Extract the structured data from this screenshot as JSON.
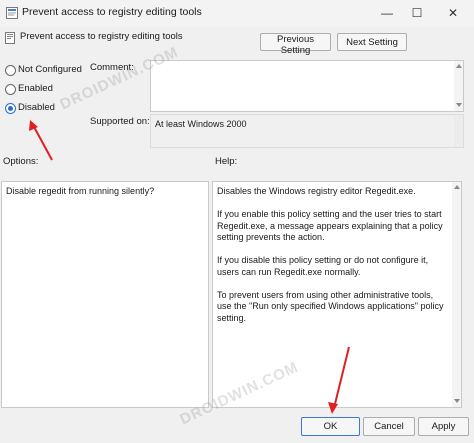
{
  "window": {
    "title": "Prevent access to registry editing tools",
    "minimize_glyph": "—",
    "maximize_glyph": "☐",
    "close_glyph": "✕"
  },
  "header": {
    "policy_title": "Prevent access to registry editing tools",
    "previous_label": "Previous Setting",
    "next_label": "Next Setting"
  },
  "state": {
    "options": [
      {
        "label": "Not Configured",
        "selected": false
      },
      {
        "label": "Enabled",
        "selected": false
      },
      {
        "label": "Disabled",
        "selected": true
      }
    ]
  },
  "comment": {
    "label": "Comment:",
    "value": ""
  },
  "supported": {
    "label": "Supported on:",
    "value": "At least Windows 2000"
  },
  "options_panel": {
    "label": "Options:",
    "text": "Disable regedit from running silently?"
  },
  "help_panel": {
    "label": "Help:",
    "text": "Disables the Windows registry editor Regedit.exe.\n\nIf you enable this policy setting and the user tries to start Regedit.exe, a message appears explaining that a policy setting prevents the action.\n\nIf you disable this policy setting or do not configure it, users can run Regedit.exe normally.\n\nTo prevent users from using other administrative tools, use the \"Run only specified Windows applications\" policy setting."
  },
  "footer": {
    "ok_label": "OK",
    "cancel_label": "Cancel",
    "apply_label": "Apply"
  },
  "watermark": "DROIDWIN.COM",
  "colors": {
    "accent": "#2b6cd1",
    "annotation_arrow": "#e02020",
    "window_bg": "#f0f0f0"
  }
}
